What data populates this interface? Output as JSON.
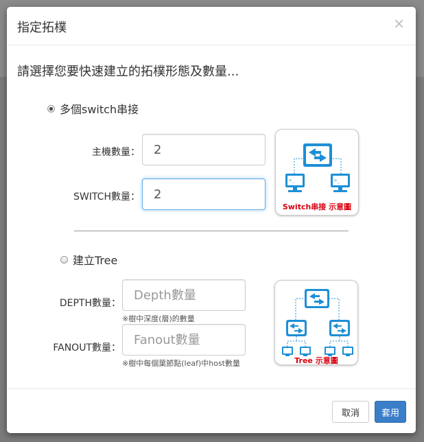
{
  "dialog": {
    "title": "指定拓樸",
    "close_glyph": "×",
    "prompt": "請選擇您要快速建立的拓樸形態及數量..."
  },
  "option_switch": {
    "label": "多個switch串接",
    "selected": true,
    "host_label": "主機數量：",
    "host_value": "2",
    "switch_label": "SWITCH數量：",
    "switch_value": "2",
    "diagram_caption": "Switch串接 示意圖",
    "diagram_icons": [
      "switch-icon",
      "host-computer-icon",
      "host-computer-icon"
    ]
  },
  "option_tree": {
    "label": "建立Tree",
    "selected": false,
    "depth_label": "DEPTH數量：",
    "depth_placeholder": "Depth數量",
    "depth_hint": "※樹中深度(層)的數量",
    "fanout_label": "FANOUT數量：",
    "fanout_placeholder": "Fanout數量",
    "fanout_hint": "※樹中每個葉節點(leaf)中host數量",
    "diagram_caption": "Tree 示意圖",
    "diagram_icons": [
      "switch-icon",
      "switch-icon",
      "switch-icon",
      "host-computer-icon",
      "host-computer-icon",
      "host-computer-icon",
      "host-computer-icon"
    ]
  },
  "footer": {
    "cancel_label": "取消",
    "apply_label": "套用"
  },
  "colors": {
    "primary": "#3a7dc9",
    "icon_blue": "#1d8fd6",
    "caption_red": "#d7000f",
    "focus_border": "#66afe9"
  }
}
